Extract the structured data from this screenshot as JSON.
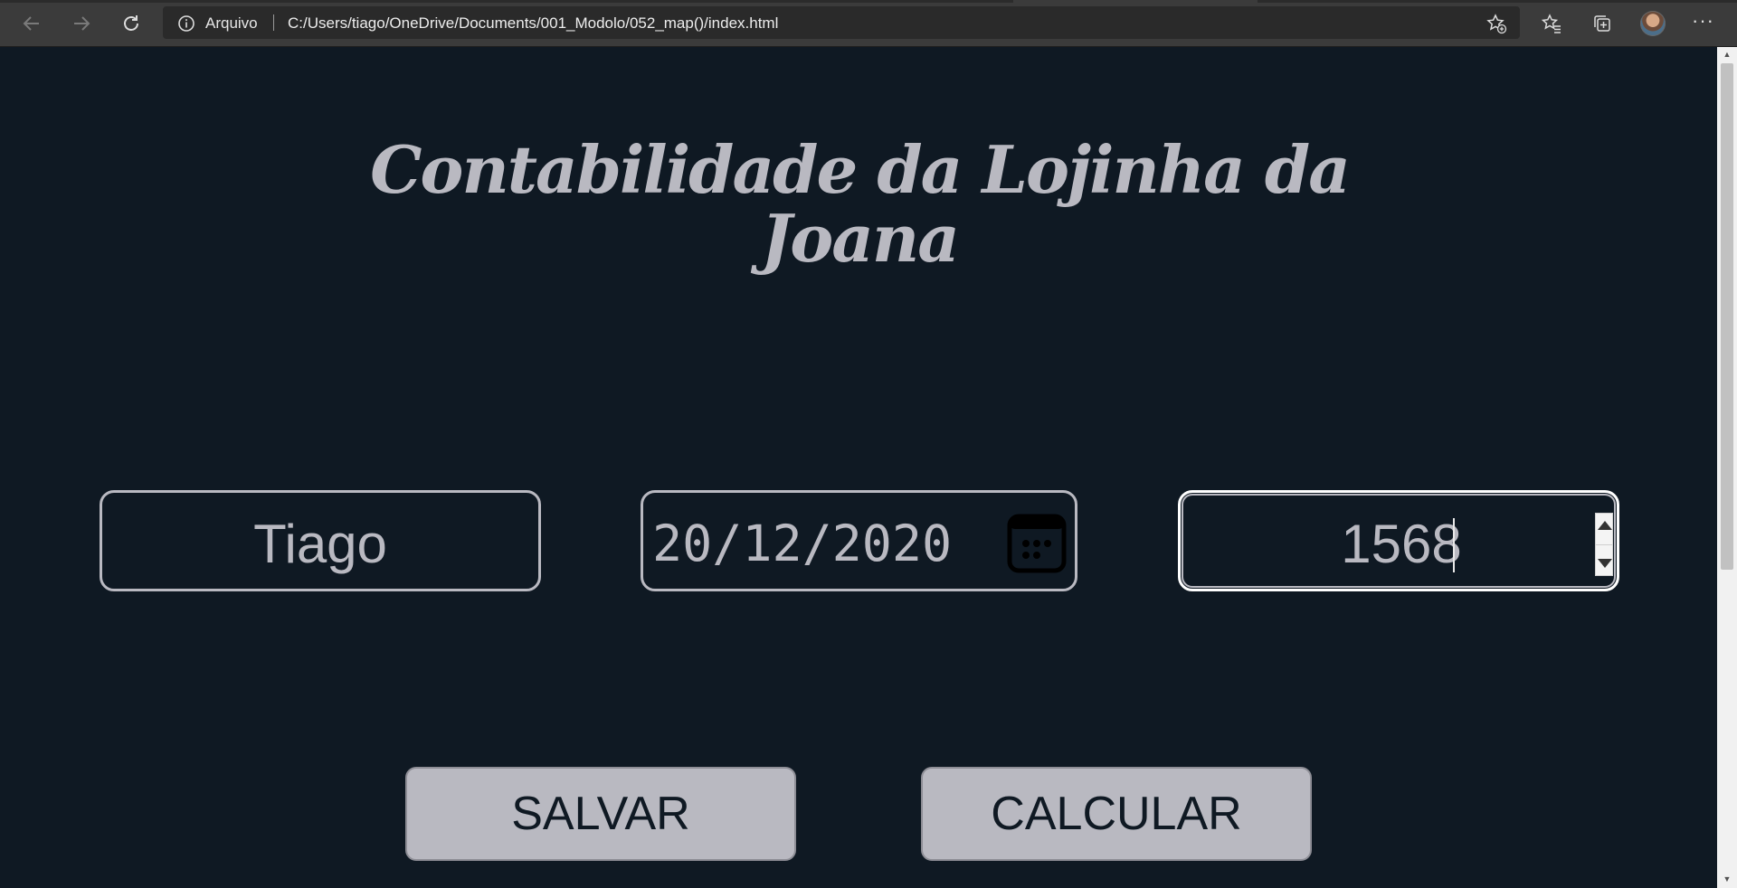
{
  "browser": {
    "protocol_label": "Arquivo",
    "url": "C:/Users/tiago/OneDrive/Documents/001_Modolo/052_map()/index.html",
    "more_label": "···",
    "icons": [
      "back-arrow-icon",
      "forward-arrow-icon",
      "reload-icon",
      "info-icon",
      "add-favorite-icon",
      "favorites-icon",
      "collections-icon",
      "profile-avatar",
      "more-icon"
    ]
  },
  "page": {
    "title_line1": "Contabilidade da Lojinha da",
    "title_line2": "Joana",
    "inputs": {
      "name_value": "Tiago",
      "date_value": "20/12/2020",
      "amount_value": "1568"
    },
    "buttons": {
      "save_label": "SALVAR",
      "calculate_label": "CALCULAR"
    }
  },
  "colors": {
    "background": "#0f1923",
    "foreground": "#b9b9c1",
    "chrome": "#3b3b3b"
  }
}
